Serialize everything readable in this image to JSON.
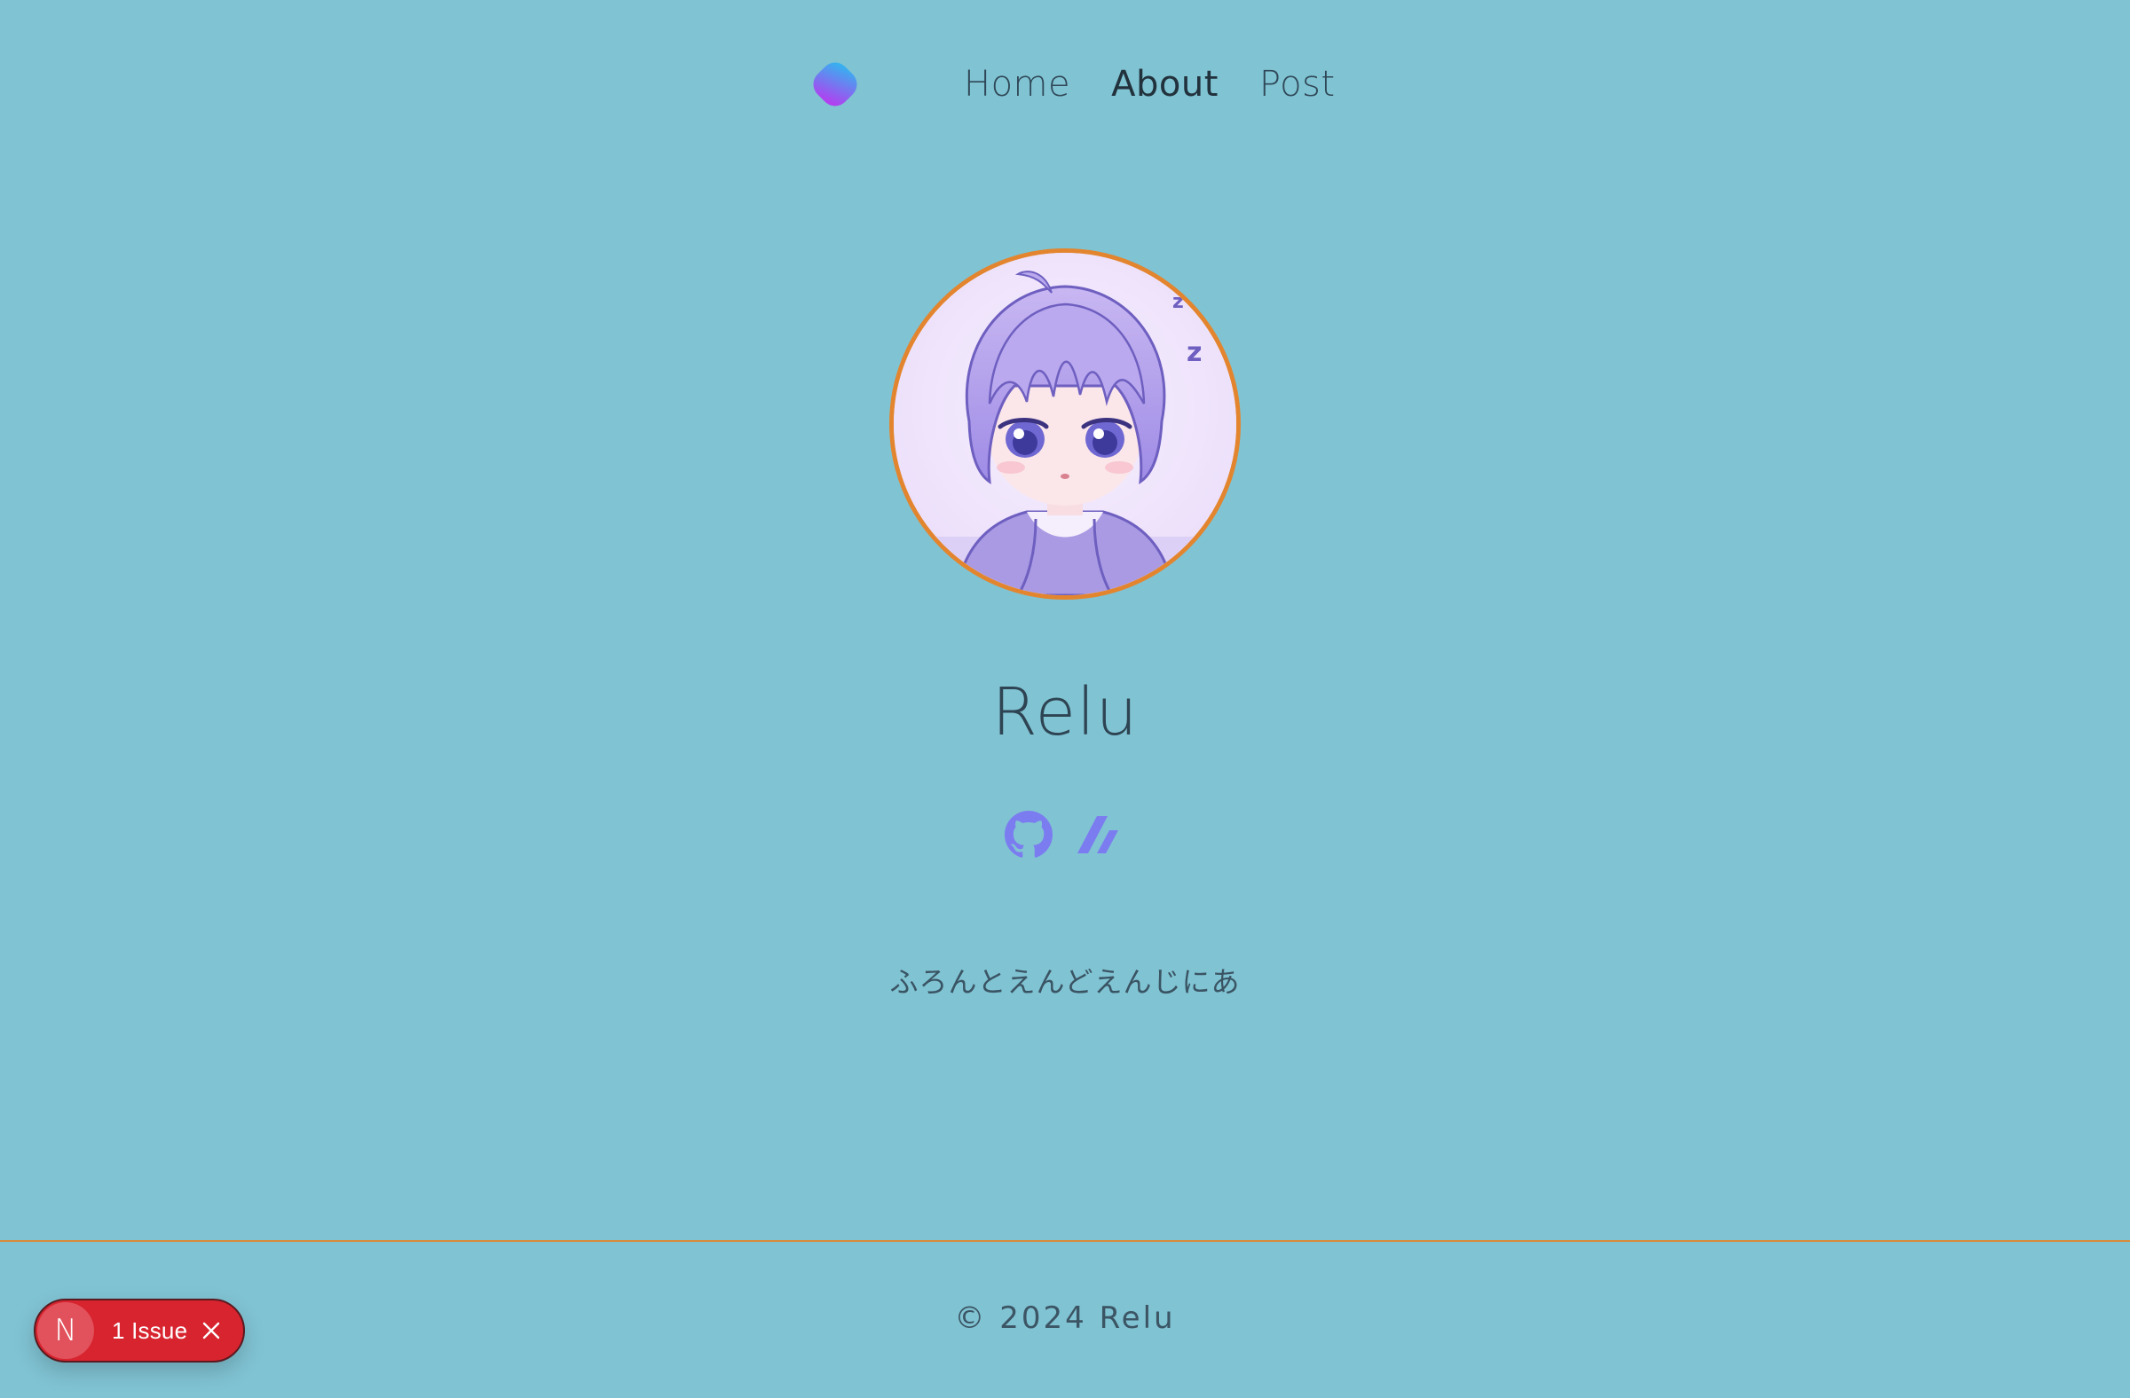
{
  "nav": {
    "items": [
      {
        "label": "Home",
        "active": false
      },
      {
        "label": "About",
        "active": true
      },
      {
        "label": "Post",
        "active": false
      }
    ]
  },
  "profile": {
    "name": "Relu",
    "bio": "ふろんとえんどえんじにあ",
    "social": [
      {
        "icon": "github-icon"
      },
      {
        "icon": "zenn-icon"
      }
    ]
  },
  "footer": {
    "copyright": "© 2024 Relu"
  },
  "issue_badge": {
    "letter": "N",
    "label": "1 Issue"
  },
  "colors": {
    "background": "#80c3d3",
    "accent": "#e3852e",
    "icon": "#7b7cf0",
    "badge": "#d7242f"
  }
}
